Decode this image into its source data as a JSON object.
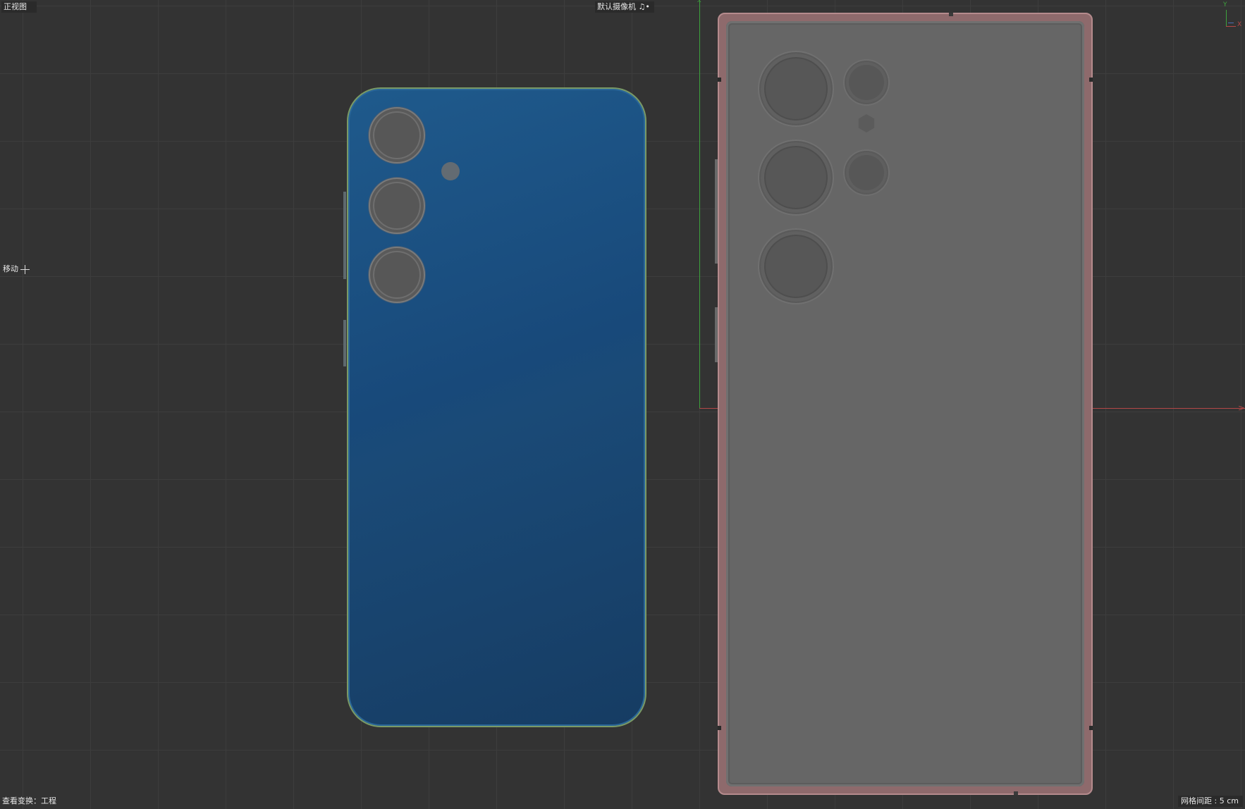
{
  "viewport": {
    "view_name": "正视图",
    "camera_name": "默认摄像机 ♫•",
    "tool_label": "移动",
    "view_transform": "查看变换：工程",
    "grid_spacing": "网格间距 : 5 cm"
  },
  "gizmo": {
    "x_label": "X",
    "y_label": "Y"
  },
  "colors": {
    "background": "#333333",
    "grid": "#3d3d3d",
    "y_axis": "#3da23d",
    "x_axis": "#b34747",
    "phone_blue": "#1a4a77",
    "phone_blue_frame": "#7a9a66",
    "phone_gray": "#666666",
    "phone_gray_frame": "#b58b8d"
  },
  "models": [
    {
      "name": "phone-blue",
      "cameras": 3,
      "flash": true
    },
    {
      "name": "phone-gray",
      "cameras": 5,
      "flash": true
    }
  ]
}
